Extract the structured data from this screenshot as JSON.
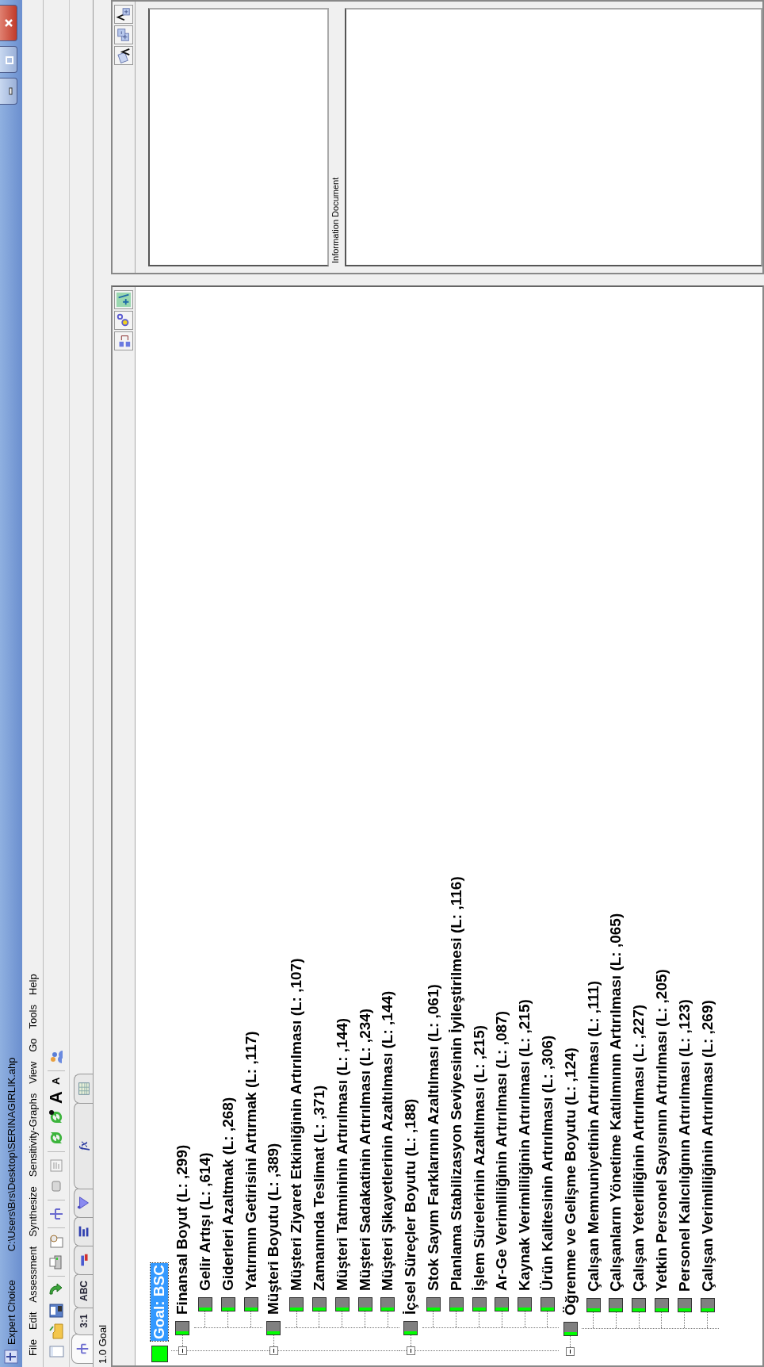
{
  "window": {
    "app_title": "Expert Choice",
    "file_path": "C:\\Users\\Brs\\Desktop\\SERINAGIRLIK.ahp"
  },
  "menu": [
    "File",
    "Edit",
    "Assessment",
    "Synthesize",
    "Sensitivity-Graphs",
    "View",
    "Go",
    "Tools",
    "Help"
  ],
  "font_buttons": [
    "A",
    "A"
  ],
  "mode_tabs": [
    {
      "selected": true
    },
    {
      "label": "3:1",
      "selected": false
    },
    {
      "label": "ABC",
      "selected": false
    },
    {
      "selected": false
    },
    {
      "selected": false
    },
    {
      "selected": false
    },
    {
      "label": "fx",
      "selected": false
    },
    {
      "selected": false
    }
  ],
  "status": "1.0 Goal",
  "panel_label": "Information Document",
  "tree": {
    "label": "Goal: BSC",
    "selected": true,
    "children": [
      {
        "label": "Finansal Boyut (L: ,299)",
        "selected": false,
        "expanded": true,
        "children": [
          {
            "label": "Gelir Artışı (L: ,614)",
            "selected": false
          },
          {
            "label": "Giderleri Azaltmak (L: ,268)",
            "selected": false
          },
          {
            "label": "Yatırımın Getirisini Artırmak (L: ,117)",
            "selected": false
          }
        ]
      },
      {
        "label": "Müşteri Boyutu (L: ,389)",
        "selected": false,
        "expanded": true,
        "children": [
          {
            "label": "Müşteri Ziyaret Etkinliğinin Artırılması (L: ,107)",
            "selected": false
          },
          {
            "label": "Zamanında Teslimat (L: ,371)",
            "selected": false
          },
          {
            "label": "Müşteri Tatmininin Artırılması (L: ,144)",
            "selected": false
          },
          {
            "label": "Müşteri Sadakatinin Artırılması (L: ,234)",
            "selected": false
          },
          {
            "label": "Müşteri Şikayetlerinin Azaltılması (L: ,144)",
            "selected": false
          }
        ]
      },
      {
        "label": "İçsel Süreçler Boyutu (L: ,188)",
        "selected": false,
        "expanded": true,
        "children": [
          {
            "label": "Stok Sayım Farklarının Azaltılması (L: ,061)",
            "selected": false
          },
          {
            "label": "Planlama Stabilizasyon Seviyesinin İyileştirilmesi (L: ,116)",
            "selected": false
          },
          {
            "label": "İşlem Sürelerinin Azaltılması (L: ,215)",
            "selected": false
          },
          {
            "label": "Ar-Ge Verimliliğinin Artırılması (L: ,087)",
            "selected": false
          },
          {
            "label": "Kaynak Verimliliğinin Artırılması (L: ,215)",
            "selected": false
          },
          {
            "label": "Ürün Kalitesinin Artırılması (L: ,306)",
            "selected": false
          }
        ]
      },
      {
        "label": "Öğrenme ve Gelişme Boyutu (L: ,124)",
        "selected": false,
        "expanded": true,
        "children": [
          {
            "label": "Çalışan Memnuniyetinin Artırılması (L: ,111)",
            "selected": false
          },
          {
            "label": "Çalışanların Yönetime Katılımının Artırılması (L: ,065)",
            "selected": false
          },
          {
            "label": "Çalışan Yeterliliğinin Artırılması (L: ,227)",
            "selected": false
          },
          {
            "label": "Yetkin Personel Sayısının Artırılması (L: ,205)",
            "selected": false
          },
          {
            "label": "Personel Kalıcılığının Artırılması (L: ,123)",
            "selected": false
          },
          {
            "label": "Çalışan Verimliliğinin Artırılması (L: ,269)",
            "selected": false
          }
        ]
      }
    ]
  }
}
